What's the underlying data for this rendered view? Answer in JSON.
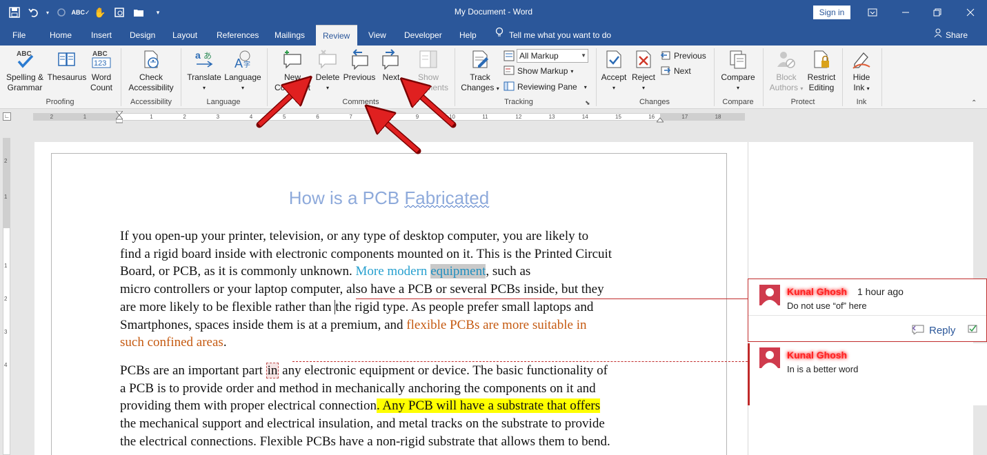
{
  "titlebar": {
    "title": "My Document  -  Word",
    "signin": "Sign in",
    "qat_icons": [
      "save-icon",
      "undo-icon",
      "redo-icon",
      "spelling-check-icon",
      "touch-mode-icon",
      "print-preview-icon",
      "open-folder-icon",
      "customize-qat-icon"
    ]
  },
  "tabs": [
    "File",
    "Home",
    "Insert",
    "Design",
    "Layout",
    "References",
    "Mailings",
    "Review",
    "View",
    "Developer",
    "Help"
  ],
  "active_tab": "Review",
  "tell_me": "Tell me what you want to do",
  "share": "Share",
  "ribbon": {
    "spelling": "Spelling &",
    "spelling2": "Grammar",
    "spelling_icon_text": "ABC",
    "thesaurus": "Thesaurus",
    "wordcount": "Word",
    "wordcount2": "Count",
    "wordcount_icon_top": "ABC",
    "wordcount_icon_bottom": "123",
    "proofing": "Proofing",
    "check_access": "Check",
    "check_access2": "Accessibility",
    "accessibility": "Accessibility",
    "translate": "Translate",
    "language_btn": "Language",
    "language": "Language",
    "new_comment": "New",
    "new_comment2": "Comment",
    "delete": "Delete",
    "previous": "Previous",
    "next": "Next",
    "show_comments": "Show",
    "show_comments2": "Comments",
    "comments": "Comments",
    "track_changes": "Track",
    "track_changes2": "Changes",
    "markup_select": "All Markup",
    "show_markup": "Show Markup",
    "reviewing_pane": "Reviewing Pane",
    "tracking": "Tracking",
    "accept": "Accept",
    "reject": "Reject",
    "change_previous": "Previous",
    "change_next": "Next",
    "changes": "Changes",
    "compare_btn": "Compare",
    "compare": "Compare",
    "block_authors": "Block",
    "block_authors2": "Authors",
    "restrict_editing": "Restrict",
    "restrict_editing2": "Editing",
    "protect": "Protect",
    "hide_ink": "Hide",
    "hide_ink2": "Ink",
    "ink": "Ink"
  },
  "ruler_numbers": [
    "2",
    "1",
    "1",
    "2",
    "3",
    "4",
    "5",
    "6",
    "7",
    "8",
    "9",
    "10",
    "11",
    "12",
    "13",
    "14",
    "15",
    "16",
    "17",
    "18"
  ],
  "vruler_numbers": [
    "2",
    "1",
    "1",
    "2",
    "3",
    "4"
  ],
  "document": {
    "heading_a": "How is a PCB ",
    "heading_b": "Fabricated",
    "p1": {
      "l1": "If you open-up your printer, television, or any type of desktop computer, you are likely to",
      "l2": "find a rigid board inside with electronic components mounted on it. This is the Printed Circuit",
      "l3a": "Board, or PCB, as it is commonly unknown. ",
      "l3b": "More modern ",
      "l3c": "equipment",
      "l3d": ", such as",
      "l4": "micro controllers or your laptop computer, also have a PCB or several PCBs inside, but they",
      "l5a": "are more likely to be flexible rather than ",
      "l5b": "the rigid type. As people prefer small laptops and",
      "l6a": "Smartphones, spaces inside them is at a premium, and ",
      "l6b": "flexible PCBs are more suitable in",
      "l7a": "such confined areas",
      "l7b": "."
    },
    "p2": {
      "l1a": "PCBs are an important part ",
      "l1b": "in",
      "l1c": " any electronic equipment or device. The basic functionality of",
      "l2": "a PCB is to provide order and method in mechanically anchoring the components on it and",
      "l3a": "providing them with proper electrical connection",
      "l3b": ". Any PCB will have a substrate that offers",
      "l4": "the mechanical support and electrical insulation, and metal tracks on the substrate to provide",
      "l5": "the electrical connections. Flexible PCBs have a non-rigid substrate that allows them to bend."
    }
  },
  "comments": [
    {
      "author": "Kunal Ghosh",
      "time": "1 hour ago",
      "text": "Do not use “of” here",
      "reply": "Reply"
    },
    {
      "author": "Kunal Ghosh",
      "text": "In is a better word"
    }
  ],
  "colors": {
    "title_bar": "#2b579a",
    "ribbon": "#f3f3f3",
    "heading": "#8eaadb",
    "comment_accent": "#c02a2a",
    "annotation_arrow": "#e02020"
  }
}
